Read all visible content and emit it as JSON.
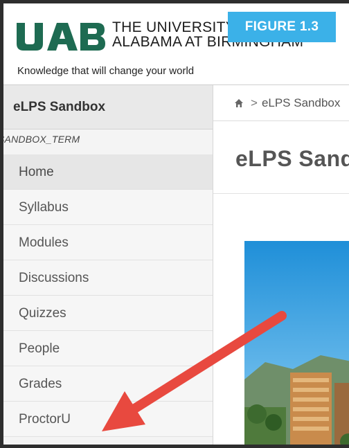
{
  "header": {
    "logo_text": "UAB",
    "university_line1": "THE UNIVERSITY OF",
    "university_line2": "ALABAMA AT BIRMINGHAM",
    "tagline": "Knowledge that will change your world",
    "figure_badge": "FIGURE 1.3",
    "brand_green": "#1e6b52",
    "badge_color": "#3bb1e8"
  },
  "sidebar": {
    "course_title": "eLPS Sandbox",
    "term": "SANDBOX_TERM",
    "items": [
      {
        "label": "Home",
        "active": true
      },
      {
        "label": "Syllabus"
      },
      {
        "label": "Modules"
      },
      {
        "label": "Discussions"
      },
      {
        "label": "Quizzes"
      },
      {
        "label": "People"
      },
      {
        "label": "Grades"
      },
      {
        "label": "ProctorU"
      }
    ]
  },
  "main": {
    "breadcrumb": {
      "home_icon": "home-icon",
      "separator": ">",
      "current": "eLPS Sandbox"
    },
    "page_title": "eLPS Sandbox"
  },
  "annotation": {
    "arrow_color": "#e8493f",
    "points_to": "ProctorU"
  }
}
